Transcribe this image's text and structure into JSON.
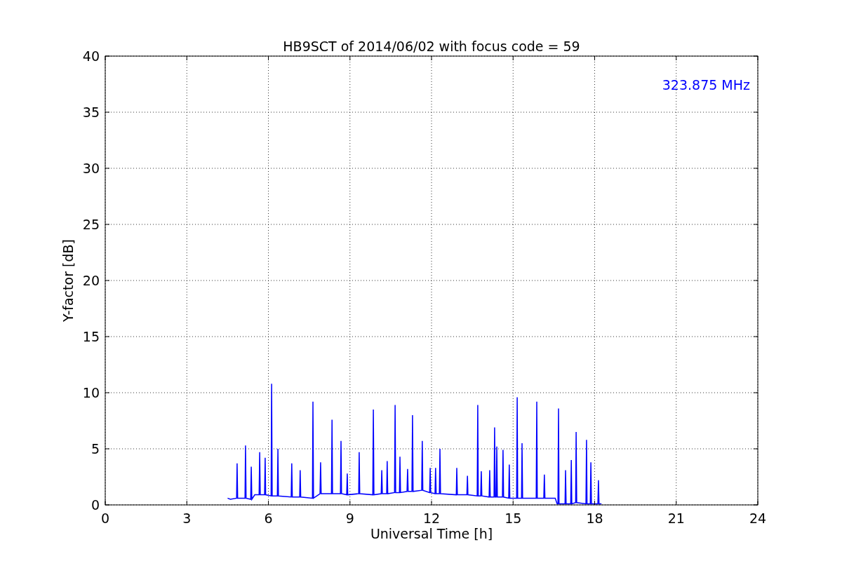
{
  "chart_data": {
    "type": "line",
    "title": "HB9SCT of 2014/06/02 with focus code = 59",
    "xlabel": "Universal Time [h]",
    "ylabel": "Y-factor [dB]",
    "xlim": [
      0,
      24
    ],
    "ylim": [
      0,
      40
    ],
    "xticks": [
      0,
      3,
      6,
      9,
      12,
      15,
      18,
      21,
      24
    ],
    "yticks": [
      0,
      5,
      10,
      15,
      20,
      25,
      30,
      35,
      40
    ],
    "series": [
      {
        "name": "323.875 MHz",
        "color": "#0000ff",
        "x": [
          4.5,
          4.6,
          4.83,
          4.85,
          4.87,
          5.14,
          5.16,
          5.18,
          5.35,
          5.37,
          5.39,
          5.5,
          5.66,
          5.68,
          5.7,
          5.86,
          5.88,
          5.9,
          6.1,
          6.12,
          6.14,
          6.33,
          6.35,
          6.37,
          6.84,
          6.86,
          6.88,
          7.15,
          7.17,
          7.19,
          7.62,
          7.64,
          7.66,
          7.9,
          7.92,
          7.94,
          8.32,
          8.34,
          8.36,
          8.65,
          8.67,
          8.69,
          8.88,
          8.9,
          8.92,
          9.32,
          9.34,
          9.36,
          9.84,
          9.86,
          9.88,
          10.15,
          10.17,
          10.19,
          10.35,
          10.37,
          10.39,
          10.64,
          10.66,
          10.68,
          10.82,
          10.84,
          10.86,
          11.1,
          11.12,
          11.14,
          11.28,
          11.3,
          11.32,
          11.64,
          11.66,
          11.68,
          11.93,
          11.95,
          11.97,
          12.13,
          12.15,
          12.17,
          12.29,
          12.31,
          12.33,
          12.91,
          12.93,
          12.95,
          13.3,
          13.32,
          13.34,
          13.68,
          13.7,
          13.72,
          13.81,
          13.83,
          13.85,
          14.12,
          14.14,
          14.16,
          14.3,
          14.32,
          14.34,
          14.38,
          14.4,
          14.42,
          14.61,
          14.63,
          14.65,
          14.84,
          14.86,
          14.88,
          15.13,
          15.15,
          15.17,
          15.31,
          15.33,
          15.35,
          15.85,
          15.87,
          15.89,
          16.13,
          16.15,
          16.17,
          16.55,
          16.62,
          16.65,
          16.67,
          16.69,
          16.91,
          16.93,
          16.95,
          17.12,
          17.14,
          17.16,
          17.3,
          17.32,
          17.34,
          17.68,
          17.7,
          17.72,
          17.84,
          17.86,
          17.88,
          18.12,
          18.14,
          18.16,
          18.25
        ],
        "values": [
          0.6,
          0.5,
          0.6,
          3.7,
          0.6,
          0.6,
          5.3,
          0.6,
          0.5,
          3.4,
          0.5,
          0.9,
          0.9,
          4.7,
          0.9,
          0.9,
          4.2,
          0.9,
          0.8,
          10.8,
          0.8,
          0.8,
          5.0,
          0.8,
          0.7,
          3.7,
          0.7,
          0.7,
          3.1,
          0.7,
          0.6,
          9.2,
          0.6,
          1.0,
          3.8,
          1.0,
          1.0,
          7.6,
          1.0,
          1.0,
          5.7,
          1.0,
          0.9,
          2.8,
          0.9,
          1.0,
          4.7,
          1.0,
          0.9,
          8.5,
          0.9,
          1.0,
          3.1,
          1.0,
          1.0,
          3.9,
          1.0,
          1.1,
          8.9,
          1.1,
          1.1,
          4.3,
          1.1,
          1.2,
          3.2,
          1.2,
          1.2,
          8.0,
          1.2,
          1.3,
          5.7,
          1.3,
          1.1,
          3.3,
          1.1,
          1.0,
          3.3,
          1.0,
          1.0,
          5.0,
          1.0,
          0.9,
          3.3,
          0.9,
          0.9,
          2.6,
          0.9,
          0.8,
          8.9,
          0.8,
          0.8,
          3.0,
          0.8,
          0.7,
          3.1,
          0.7,
          0.7,
          6.9,
          0.7,
          0.7,
          5.2,
          0.7,
          0.7,
          4.9,
          0.7,
          0.6,
          3.6,
          0.6,
          0.6,
          9.6,
          0.6,
          0.6,
          5.5,
          0.6,
          0.6,
          9.2,
          0.6,
          0.6,
          2.7,
          0.6,
          0.6,
          0.1,
          0.1,
          8.6,
          0.1,
          0.1,
          3.1,
          0.1,
          0.1,
          4.0,
          0.1,
          0.2,
          6.5,
          0.2,
          0.1,
          5.8,
          0.1,
          0.1,
          3.8,
          0.1,
          0.1,
          2.2,
          0.1,
          0.1
        ]
      }
    ],
    "grid": true
  }
}
